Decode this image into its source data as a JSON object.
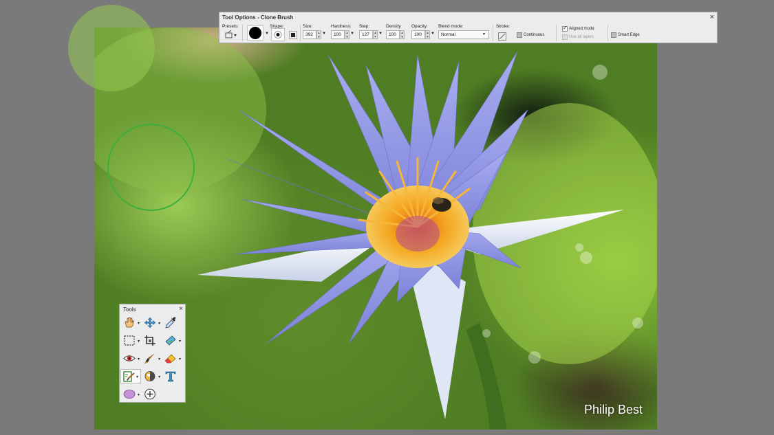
{
  "tool_options": {
    "title": "Tool Options - Clone Brush",
    "close_glyph": "×",
    "presets_label": "Presets:",
    "shape_label": "Shape:",
    "size_label": "Size:",
    "size_value": "392",
    "hardness_label": "Hardness:",
    "hardness_value": "100",
    "step_label": "Step:",
    "step_value": "127",
    "density_label": "Density",
    "density_value": "100",
    "opacity_label": "Opacity:",
    "opacity_value": "100",
    "blend_mode_label": "Blend mode:",
    "blend_mode_value": "Normal",
    "stroke_label": "Stroke:",
    "continuous_label": "Continuous",
    "continuous_checked": false,
    "aligned_mode_label": "Aligned mode",
    "aligned_mode_checked": true,
    "use_all_layers_label": "Use all layers",
    "use_all_layers_checked": false,
    "smart_edge_label": "Smart Edge",
    "smart_edge_checked": false
  },
  "tools_palette": {
    "title": "Tools",
    "close_glyph": "×",
    "tools": [
      {
        "icon": "pan-hand-icon"
      },
      {
        "icon": "move-icon"
      },
      {
        "icon": "eyedropper-icon"
      },
      {
        "icon": "selection-icon"
      },
      {
        "icon": "crop-icon"
      },
      {
        "icon": "straighten-icon"
      },
      {
        "icon": "red-eye-icon"
      },
      {
        "icon": "paint-brush-icon"
      },
      {
        "icon": "eraser-icon"
      },
      {
        "icon": "clone-brush-icon",
        "active": true
      },
      {
        "icon": "dodge-icon"
      },
      {
        "icon": "text-icon"
      },
      {
        "icon": "ellipse-shape-icon"
      },
      {
        "icon": "heal-icon"
      }
    ]
  },
  "photo": {
    "watermark": "Philip Best"
  },
  "colors": {
    "panel_bg": "#ececec",
    "workspace_bg": "#7a7a7a",
    "petal": "#8f95e6",
    "stamen": "#f4a51e"
  }
}
